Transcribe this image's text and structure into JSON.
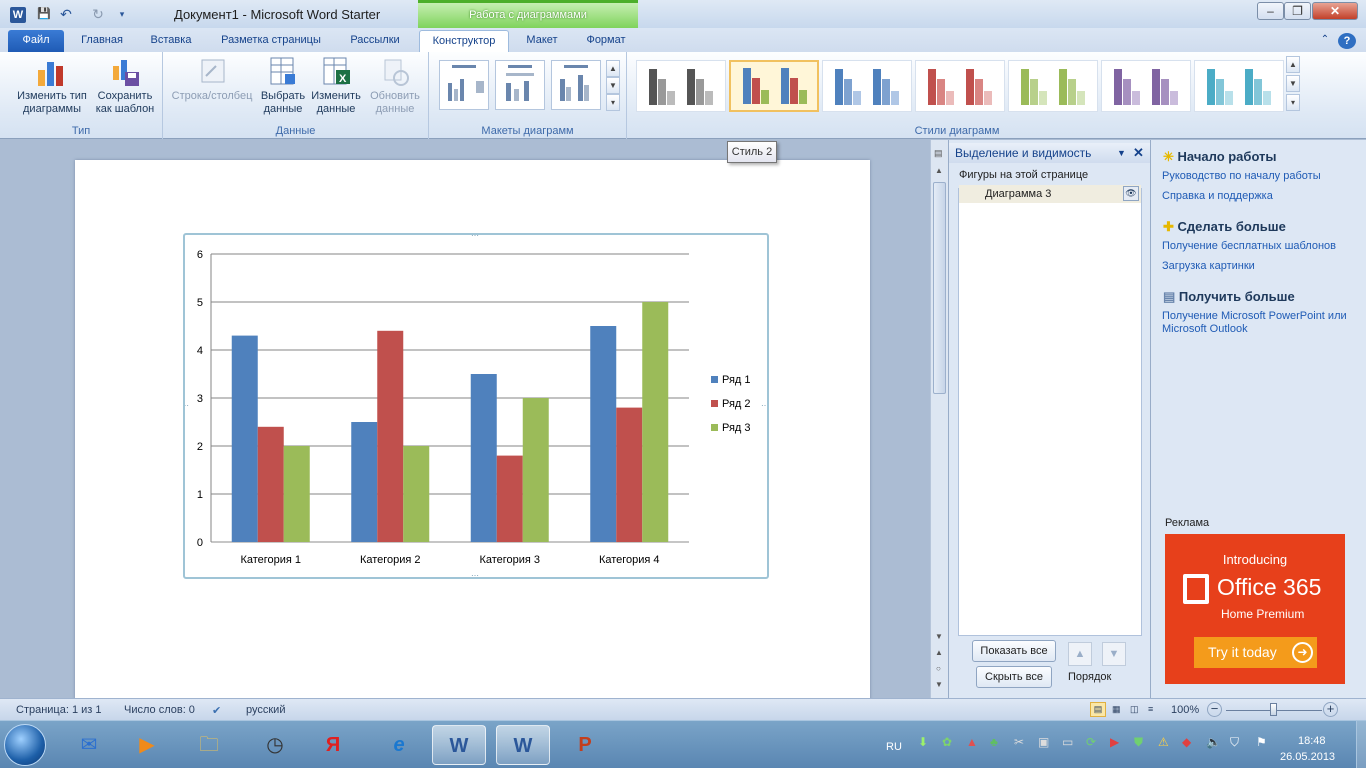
{
  "window": {
    "title": "Документ1  -  Microsoft Word Starter",
    "context_tab_group": "Работа с диаграммами",
    "buttons": {
      "minimize": "–",
      "restore": "❐",
      "close": "✕"
    }
  },
  "quick_access": {
    "save_icon": "save-icon",
    "undo_icon": "undo-icon",
    "redo_icon": "redo-icon"
  },
  "tabs": [
    {
      "label": "Файл"
    },
    {
      "label": "Главная"
    },
    {
      "label": "Вставка"
    },
    {
      "label": "Разметка страницы"
    },
    {
      "label": "Рассылки"
    },
    {
      "label": "Конструктор"
    },
    {
      "label": "Макет"
    },
    {
      "label": "Формат"
    }
  ],
  "ribbon": {
    "type_group": {
      "label": "Тип",
      "change_type": "Изменить тип диаграммы",
      "save_template": "Сохранить как шаблон"
    },
    "data_group": {
      "label": "Данные",
      "switch_row_col": "Строка/столбец",
      "select_data": "Выбрать данные",
      "edit_data": "Изменить данные",
      "refresh_data": "Обновить данные"
    },
    "layouts_group": {
      "label": "Макеты диаграмм"
    },
    "styles_group": {
      "label": "Стили диаграмм",
      "styles": [
        {
          "colors": [
            "#555555",
            "#999999",
            "#bbbbbb"
          ]
        },
        {
          "colors": [
            "#4f81bd",
            "#c0504d",
            "#9bbb59"
          ]
        },
        {
          "colors": [
            "#4f81bd",
            "#7ea2d0",
            "#b0c7e6"
          ]
        },
        {
          "colors": [
            "#c0504d",
            "#d98583",
            "#ebbbba"
          ]
        },
        {
          "colors": [
            "#9bbb59",
            "#b8d08b",
            "#d5e5bb"
          ]
        },
        {
          "colors": [
            "#8064a2",
            "#a690c0",
            "#cabcdc"
          ]
        },
        {
          "colors": [
            "#4bacc6",
            "#82c6d8",
            "#b8e0ea"
          ]
        }
      ],
      "tooltip": "Стиль 2"
    }
  },
  "chart_data": {
    "type": "bar",
    "categories": [
      "Категория 1",
      "Категория 2",
      "Категория 3",
      "Категория 4"
    ],
    "series": [
      {
        "name": "Ряд 1",
        "values": [
          4.3,
          2.5,
          3.5,
          4.5
        ],
        "color": "#4f81bd"
      },
      {
        "name": "Ряд 2",
        "values": [
          2.4,
          4.4,
          1.8,
          2.8
        ],
        "color": "#c0504d"
      },
      {
        "name": "Ряд 3",
        "values": [
          2,
          2,
          3,
          5
        ],
        "color": "#9bbb59"
      }
    ],
    "yticks": [
      "0",
      "1",
      "2",
      "3",
      "4",
      "5",
      "6"
    ],
    "ylim": [
      0,
      6
    ],
    "grid": true,
    "legend": "right"
  },
  "selection_pane": {
    "title": "Выделение и видимость",
    "shapes_label": "Фигуры на этой странице",
    "items": [
      {
        "label": "Диаграмма 3"
      }
    ],
    "show_all": "Показать все",
    "hide_all": "Скрыть все",
    "order_label": "Порядок"
  },
  "right_pane": {
    "start": {
      "title": "Начало работы",
      "links": [
        "Руководство по началу работы",
        "Справка и поддержка"
      ]
    },
    "more": {
      "title": "Сделать больше",
      "links": [
        "Получение бесплатных шаблонов",
        "Загрузка картинки"
      ]
    },
    "get_more": {
      "title": "Получить больше",
      "links": [
        "Получение Microsoft PowerPoint или Microsoft Outlook"
      ]
    },
    "ad_label": "Реклама",
    "ad": {
      "intro": "Introducing",
      "product": "Office 365",
      "edition": "Home Premium",
      "cta": "Try it today"
    }
  },
  "status_bar": {
    "page": "Страница: 1 из 1",
    "words": "Число слов: 0",
    "language": "русский",
    "zoom": "100%"
  },
  "taskbar": {
    "apps": [
      "mail-icon",
      "media-icon",
      "explorer-icon",
      "clock-icon",
      "yandex-icon",
      "ie-icon",
      "word-icon",
      "word-icon",
      "ppt-icon"
    ],
    "lang": "RU",
    "time": "18:48",
    "date": "26.05.2013"
  }
}
